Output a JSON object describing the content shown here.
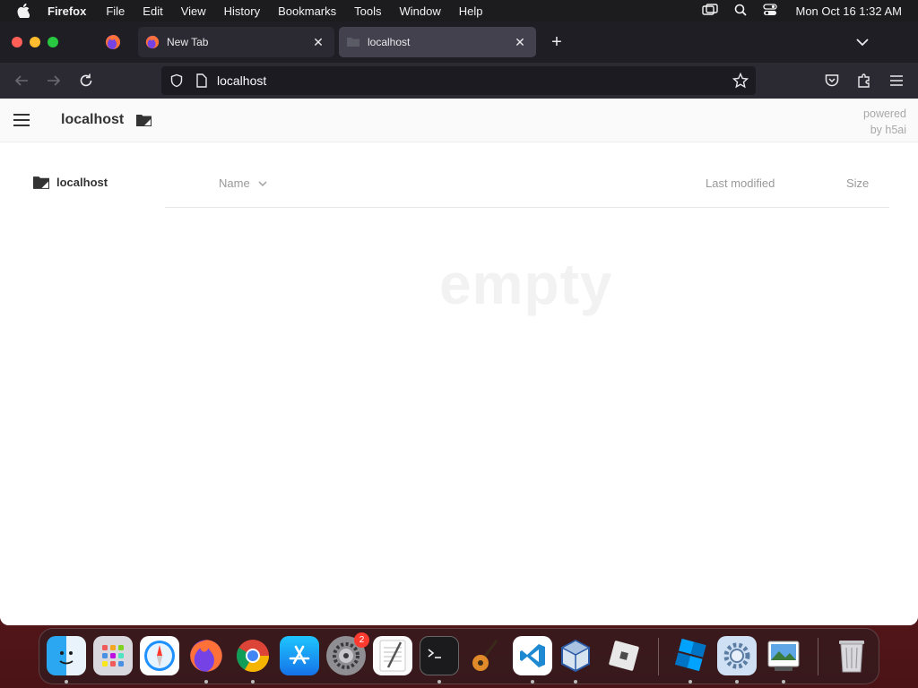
{
  "menubar": {
    "app_name": "Firefox",
    "items": [
      "File",
      "Edit",
      "View",
      "History",
      "Bookmarks",
      "Tools",
      "Window",
      "Help"
    ],
    "clock": "Mon Oct 16  1:32 AM"
  },
  "browser": {
    "tabs": [
      {
        "label": "New Tab",
        "favicon": "firefox-icon",
        "active": false
      },
      {
        "label": "localhost",
        "favicon": "folder-icon",
        "active": true
      }
    ],
    "url": "localhost"
  },
  "page": {
    "breadcrumb": "localhost",
    "powered_line1": "powered",
    "powered_line2": "by h5ai",
    "sidebar_folder": "localhost",
    "columns": {
      "name": "Name",
      "modified": "Last modified",
      "size": "Size"
    },
    "empty_text": "empty"
  },
  "dock": {
    "apps": [
      "Finder",
      "Launchpad",
      "Safari",
      "Firefox",
      "Chrome",
      "App Store",
      "System Preferences",
      "TextEdit",
      "Terminal",
      "GarageBand",
      "Visual Studio Code",
      "VirtualBox",
      "Roblox",
      "Roblox Studio",
      "Settings",
      "Preview",
      "Trash"
    ],
    "settings_badge": "2"
  }
}
